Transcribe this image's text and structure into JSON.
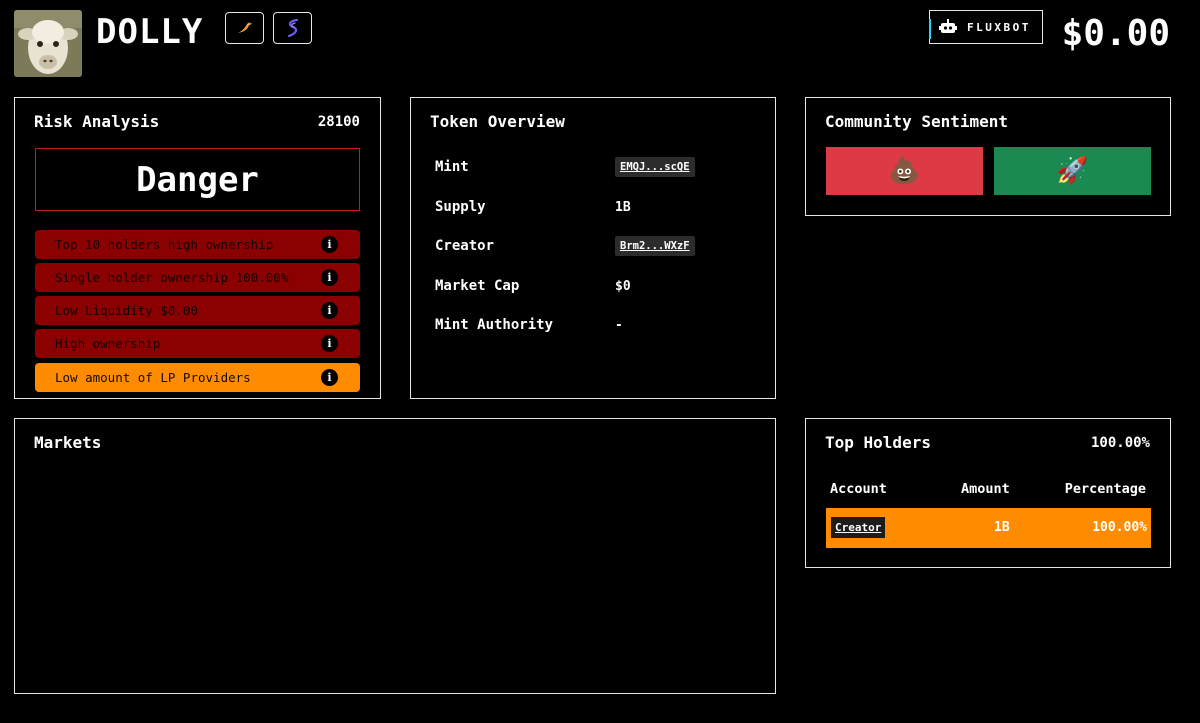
{
  "header": {
    "token_name": "DOLLY",
    "fluxbot_label": "FLUXBOT",
    "price": "$0.00"
  },
  "risk": {
    "title": "Risk Analysis",
    "score": "28100",
    "level": "Danger",
    "items": [
      {
        "label": "Top 10 holders high ownership",
        "severity": "danger"
      },
      {
        "label": "Single holder ownership 100.00%",
        "severity": "danger"
      },
      {
        "label": "Low Liquidity $0.00",
        "severity": "danger"
      },
      {
        "label": "High ownership",
        "severity": "danger"
      },
      {
        "label": "Low amount of LP Providers",
        "severity": "warning"
      }
    ]
  },
  "overview": {
    "title": "Token Overview",
    "rows": [
      {
        "label": "Mint",
        "value": "EMQJ...scQE"
      },
      {
        "label": "Supply",
        "value": "1B"
      },
      {
        "label": "Creator",
        "value": "Brm2...WXzF"
      },
      {
        "label": "Market Cap",
        "value": "$0"
      },
      {
        "label": "Mint Authority",
        "value": "-"
      }
    ]
  },
  "community": {
    "title": "Community Sentiment",
    "bear_emoji": "💩",
    "bull_emoji": "🚀"
  },
  "markets": {
    "title": "Markets"
  },
  "holders": {
    "title": "Top Holders",
    "total": "100.00%",
    "columns": [
      "Account",
      "Amount",
      "Percentage"
    ],
    "rows": [
      {
        "account": "Creator",
        "amount": "1B",
        "percentage": "100.00%"
      }
    ]
  },
  "colors": {
    "danger": "#8b0000",
    "warning": "#ff8c00",
    "bear": "#de3a45",
    "bull": "#1a8a52"
  },
  "icons": {
    "twitter": "bird-icon",
    "solana": "solana-icon",
    "fluxbot": "robot-icon",
    "info": "info-icon"
  }
}
